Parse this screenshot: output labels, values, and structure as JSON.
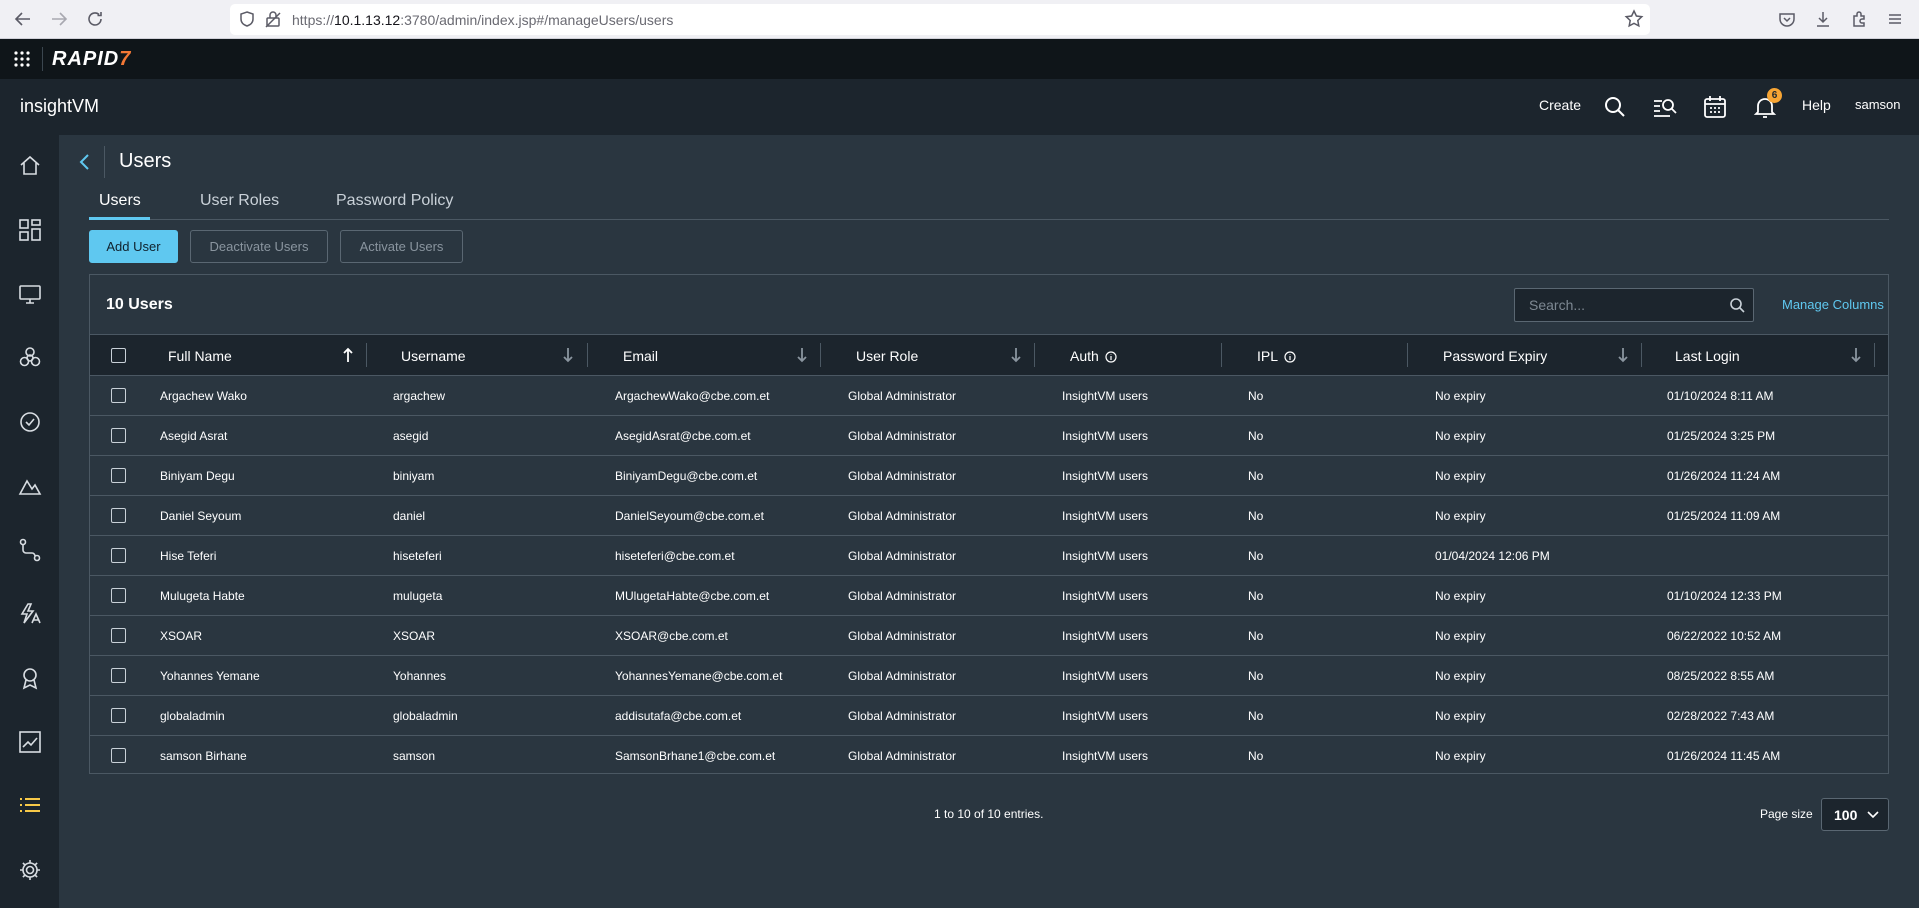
{
  "browser": {
    "url_prefix": "https://",
    "url_host": "10.1.13.12",
    "url_path": ":3780/admin/index.jsp#/manageUsers/users"
  },
  "brand": {
    "logo_text": "RAPID",
    "logo_seven": "7"
  },
  "header": {
    "product_name": "insightVM",
    "create_label": "Create",
    "notification_count": "6",
    "help_label": "Help",
    "user_label": "samson"
  },
  "page": {
    "title": "Users",
    "tabs": [
      {
        "label": "Users"
      },
      {
        "label": "User Roles"
      },
      {
        "label": "Password Policy"
      }
    ],
    "buttons": {
      "add_user": "Add User",
      "deactivate_users": "Deactivate Users",
      "activate_users": "Activate Users"
    }
  },
  "table": {
    "count_title": "10 Users",
    "search_placeholder": "Search...",
    "manage_columns": "Manage Columns",
    "columns": [
      "Full Name",
      "Username",
      "Email",
      "User Role",
      "Auth",
      "IPL",
      "Password Expiry",
      "Last Login"
    ],
    "rows": [
      [
        "Argachew Wako",
        "argachew",
        "ArgachewWako@cbe.com.et",
        "Global Administrator",
        "InsightVM users",
        "No",
        "No expiry",
        "01/10/2024 8:11 AM"
      ],
      [
        "Asegid Asrat",
        "asegid",
        "AsegidAsrat@cbe.com.et",
        "Global Administrator",
        "InsightVM users",
        "No",
        "No expiry",
        "01/25/2024 3:25 PM"
      ],
      [
        "Biniyam Degu",
        "biniyam",
        "BiniyamDegu@cbe.com.et",
        "Global Administrator",
        "InsightVM users",
        "No",
        "No expiry",
        "01/26/2024 11:24 AM"
      ],
      [
        "Daniel Seyoum",
        "daniel",
        "DanielSeyoum@cbe.com.et",
        "Global Administrator",
        "InsightVM users",
        "No",
        "No expiry",
        "01/25/2024 11:09 AM"
      ],
      [
        "Hise Teferi",
        "hiseteferi",
        "hiseteferi@cbe.com.et",
        "Global Administrator",
        "InsightVM users",
        "No",
        "01/04/2024 12:06 PM",
        ""
      ],
      [
        "Mulugeta Habte",
        "mulugeta",
        "MUlugetaHabte@cbe.com.et",
        "Global Administrator",
        "InsightVM users",
        "No",
        "No expiry",
        "01/10/2024 12:33 PM"
      ],
      [
        "XSOAR",
        "XSOAR",
        "XSOAR@cbe.com.et",
        "Global Administrator",
        "InsightVM users",
        "No",
        "No expiry",
        "06/22/2022 10:52 AM"
      ],
      [
        "Yohannes Yemane",
        "Yohannes",
        "YohannesYemane@cbe.com.et",
        "Global Administrator",
        "InsightVM users",
        "No",
        "No expiry",
        "08/25/2022 8:55 AM"
      ],
      [
        "globaladmin",
        "globaladmin",
        "addisutafa@cbe.com.et",
        "Global Administrator",
        "InsightVM users",
        "No",
        "No expiry",
        "02/28/2022 7:43 AM"
      ],
      [
        "samson Birhane",
        "samson",
        "SamsonBrhane1@cbe.com.et",
        "Global Administrator",
        "InsightVM users",
        "No",
        "No expiry",
        "01/26/2024 11:45 AM"
      ]
    ]
  },
  "pagination": {
    "summary": "1 to 10 of 10 entries.",
    "page_size_label": "Page size",
    "page_size_value": "100"
  },
  "colors": {
    "accent": "#5fc8f0",
    "background": "#2a3640",
    "header_bg": "#1c252d",
    "active_nav": "#f7c948",
    "badge": "#f7a534"
  },
  "icons": {
    "left_nav": [
      "home-icon",
      "dashboard-icon",
      "assets-icon",
      "vulnerabilities-icon",
      "policies-icon",
      "reports-icon",
      "automation-icon",
      "remediation-icon",
      "certificates-icon",
      "trends-icon",
      "list-icon",
      "settings-icon"
    ]
  }
}
